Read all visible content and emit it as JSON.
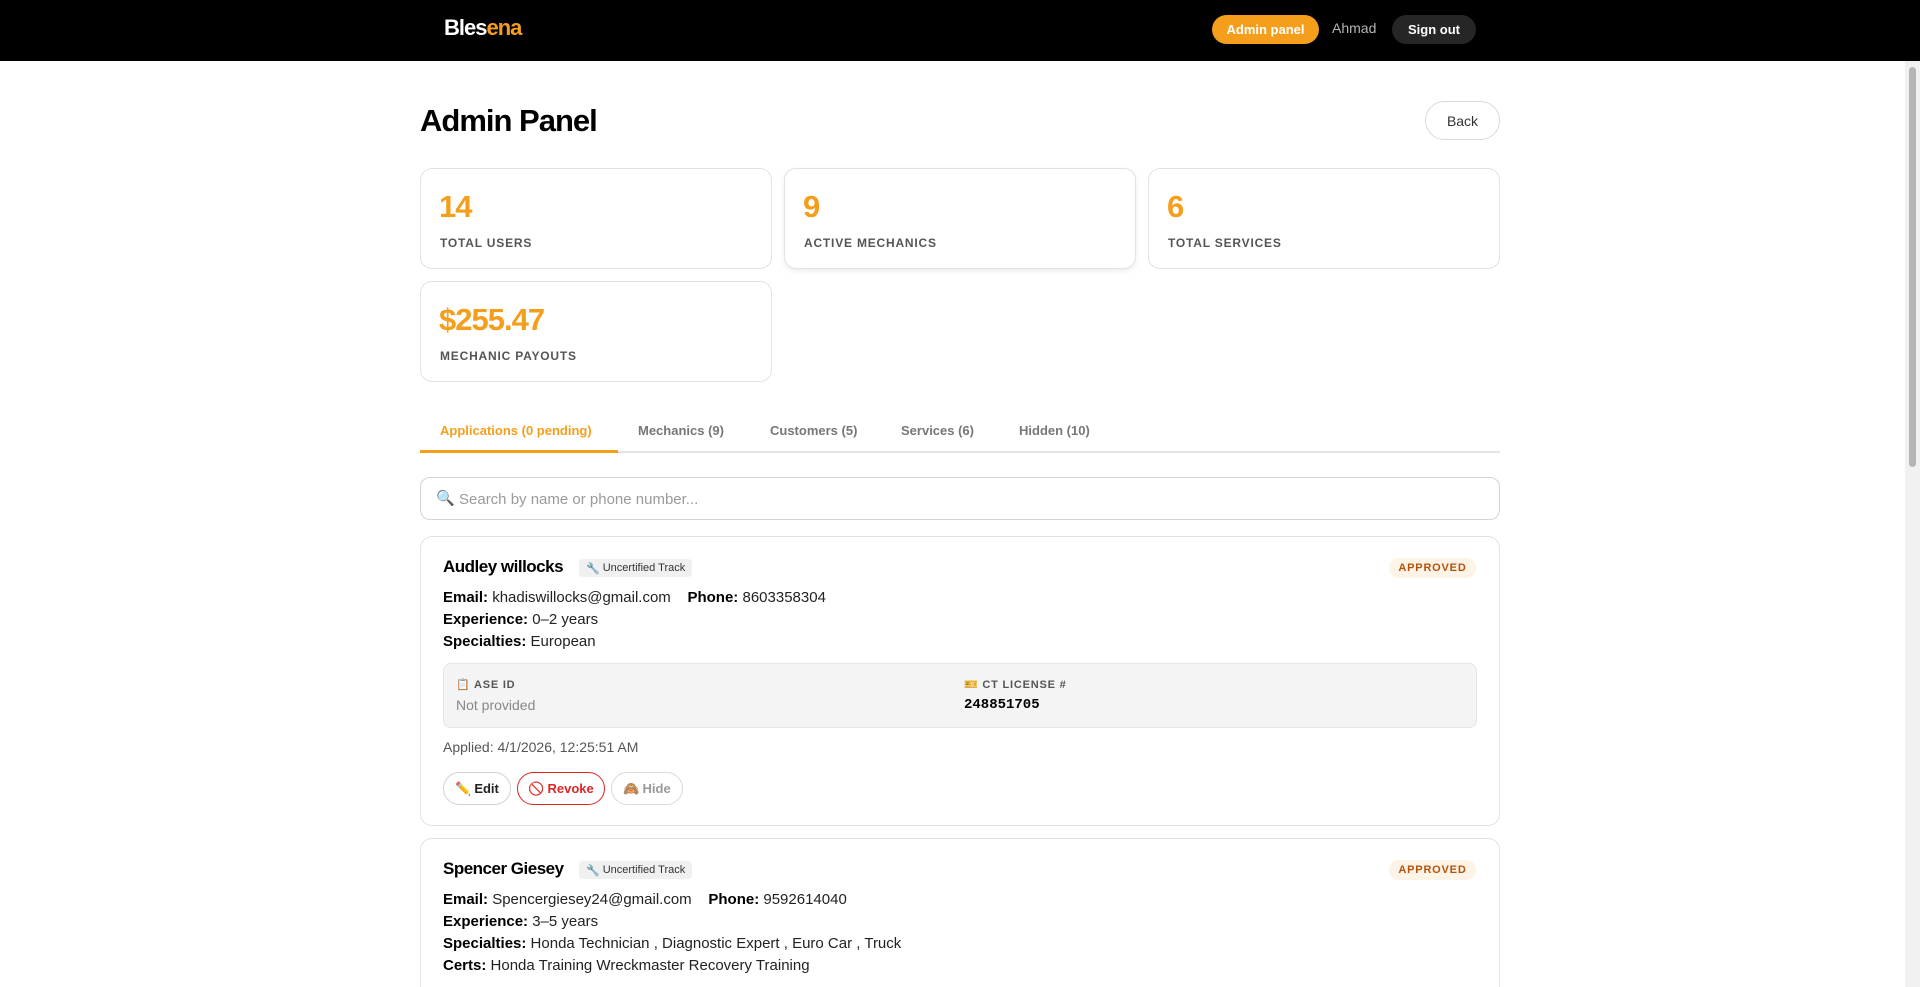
{
  "nav": {
    "logo_main": "Bles",
    "logo_accent": "ena",
    "admin_button": "Admin panel",
    "user_name": "Ahmad",
    "signout_button": "Sign out"
  },
  "page": {
    "title": "Admin Panel",
    "back_button": "Back"
  },
  "stats": [
    {
      "value": "14",
      "label": "TOTAL USERS"
    },
    {
      "value": "9",
      "label": "ACTIVE MECHANICS"
    },
    {
      "value": "6",
      "label": "TOTAL SERVICES"
    },
    {
      "value": "$255.47",
      "label": "MECHANIC PAYOUTS"
    }
  ],
  "tabs": [
    {
      "label": "Applications (0 pending)",
      "active": true
    },
    {
      "label": "Mechanics (9)",
      "active": false
    },
    {
      "label": "Customers (5)",
      "active": false
    },
    {
      "label": "Services (6)",
      "active": false
    },
    {
      "label": "Hidden (10)",
      "active": false
    }
  ],
  "search": {
    "icon": "magnifier-icon",
    "placeholder": "Search by name or phone number..."
  },
  "applications": [
    {
      "name": "Audley willocks",
      "track": "Uncertified Track",
      "status": "APPROVED",
      "email_label": "Email:",
      "email": "khadiswillocks@gmail.com",
      "phone_label": "Phone:",
      "phone": "8603358304",
      "experience_label": "Experience:",
      "experience": "0–2 years",
      "specialties_label": "Specialties:",
      "specialties": "European",
      "ase_label": "ASE ID",
      "ase_value": "Not provided",
      "license_label": "CT LICENSE #",
      "license_value": "248851705",
      "applied": "Applied: 4/1/2026, 12:25:51 AM",
      "edit_label": "Edit",
      "revoke_label": "Revoke",
      "hide_label": "Hide"
    },
    {
      "name": "Spencer Giesey",
      "track": "Uncertified Track",
      "status": "APPROVED",
      "email_label": "Email:",
      "email": "Spencergiesey24@gmail.com",
      "phone_label": "Phone:",
      "phone": "9592614040",
      "experience_label": "Experience:",
      "experience": "3–5 years",
      "specialties_label": "Specialties:",
      "specialties": "Honda Technician , Diagnostic Expert , Euro Car , Truck",
      "certs_label": "Certs:",
      "certs": "Honda Training Wreckmaster Recovery Training"
    }
  ],
  "colors": {
    "accent": "#f59e1b",
    "topbar": "#000000",
    "revoke": "#dc2626",
    "status_text": "#b45309"
  }
}
